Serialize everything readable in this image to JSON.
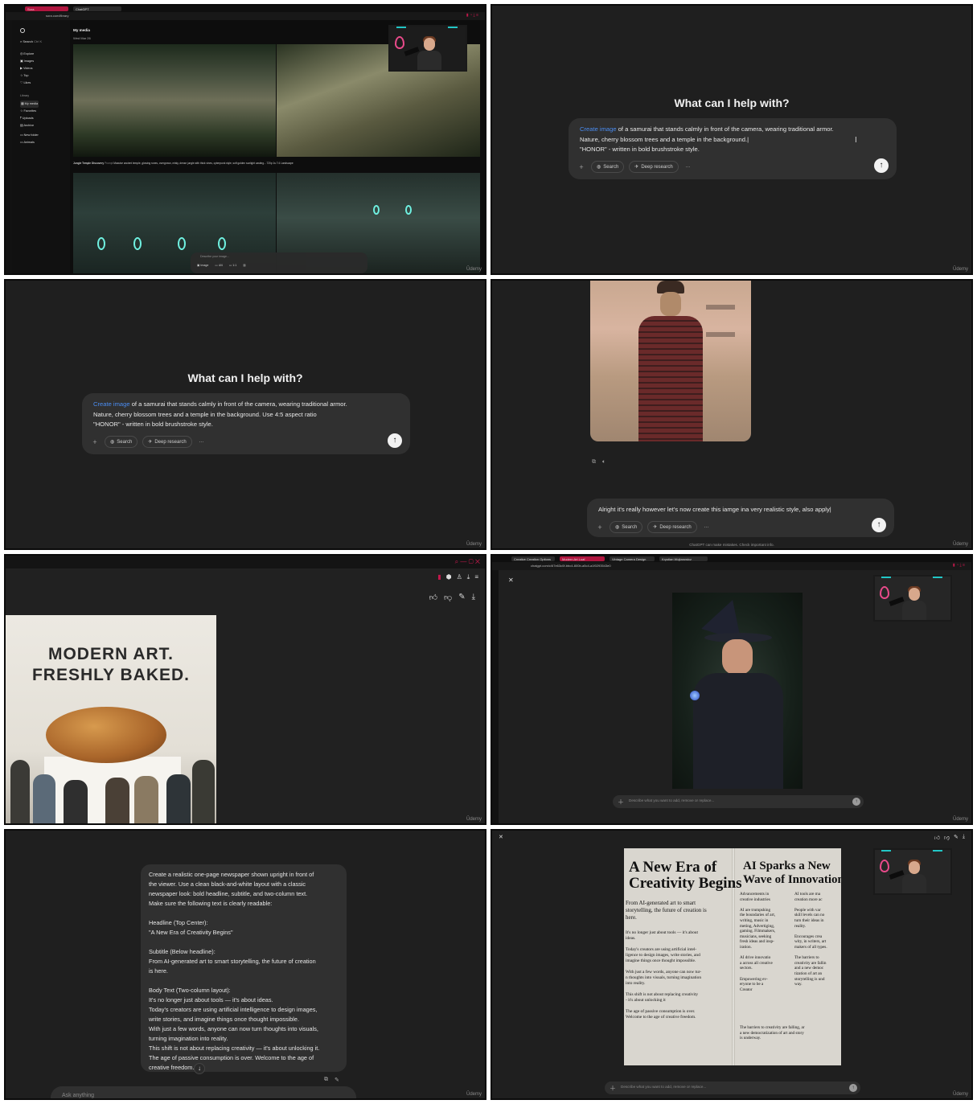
{
  "cell1": {
    "tabs": [
      "Sora",
      "ChatGPT"
    ],
    "url": "sora.com/library",
    "sidebar_search": "Search",
    "sidebar_search_shortcut": "Ctrl K",
    "nav": [
      "Explore",
      "Images",
      "Videos",
      "Top",
      "Likes"
    ],
    "library_label": "Library",
    "library": [
      "My media",
      "Favorites",
      "Uploads",
      "Archive"
    ],
    "folders": [
      "New folder",
      "Animals"
    ],
    "page_title": "My media",
    "date": "Wed Mar 26",
    "caption_title": "Jungle Temple Discovery",
    "caption_prompt_label": "Prompt",
    "caption_text": "Massive ancient temple, glowing runes, overgrown, misty, dense jungle with thick vines, cyberpunk style, soft golden sunlight casting...",
    "caption_res": "720p",
    "caption_dur": "1s",
    "caption_ratio": "7:4 Landscape",
    "composer_placeholder": "Describe your image...",
    "composer_type": "Image",
    "composer_count": "4/4",
    "composer_ratio": "1:1"
  },
  "cell2": {
    "heading": "What can I help with?",
    "link": "Create image",
    "line1": " of a samurai that stands calmly in front of the camera, wearing traditional armor.",
    "line2": "Nature, cherry blossom trees and a temple in the background.",
    "line3": "\"HONOR\" - written in bold brushstroke style.",
    "search": "Search",
    "deep": "Deep research",
    "more": "···",
    "watermark": "Ūdemy"
  },
  "cell3": {
    "heading": "What can I help with?",
    "link": "Create image",
    "line1": " of a samurai that stands calmly in front of the camera, wearing traditional armor.",
    "line2": "Nature, cherry blossom trees and a temple in the background. Use 4:5 aspect ratio",
    "line3": "\"HONOR\" - written in bold brushstroke style.",
    "search": "Search",
    "deep": "Deep research",
    "more": "···",
    "watermark": "Ūdemy"
  },
  "cell4": {
    "prompt": "Alright it's really however let's now create this iamge ina very realistic style, also apply",
    "search": "Search",
    "deep": "Deep research",
    "more": "···",
    "disclaimer": "ChatGPT can make mistakes. Check important info.",
    "watermark": "Ūdemy"
  },
  "cell5": {
    "poster_line1": "MODERN ART.",
    "poster_line2": "FRESHLY BAKED.",
    "watermark": "Ūdemy"
  },
  "cell6": {
    "tabs": [
      "Creative Creation Options",
      "Modern Art Loaf",
      "Vintage Camera Design",
      "Krystian Wojtarowicz"
    ],
    "url": "chatgpt.com/c/67e63c0f-bbc4-800b-a5c4-a1f0293543e0",
    "composer_placeholder": "Describe what you want to add, remove or replace...",
    "watermark": "Ūdemy"
  },
  "cell7": {
    "message_lines": [
      "Create a realistic one-page newspaper shown upright in front of",
      "the viewer. Use a clean black-and-white layout with a classic",
      "newspaper look: bold headline, subtitle, and two-column text.",
      "Make sure the following text is clearly readable:",
      "",
      "Headline (Top Center):",
      "\"A New Era of Creativity Begins\"",
      "",
      "Subtitle (Below headline):",
      "From AI-generated art to smart storytelling, the future of creation",
      "is here.",
      "",
      "Body Text (Two-column layout):",
      "It's no longer just about tools — it's about ideas.",
      "Today's creators are using artificial intelligence to design images,",
      "write stories, and imagine things once thought impossible.",
      "With just a few words, anyone can now turn thoughts into visuals,",
      "turning imagination into reality.",
      "This shift is not about replacing creativity — it's about unlocking it.",
      "The age of passive consumption is over. Welcome to the age of",
      "creative freedom."
    ],
    "composer_placeholder": "Ask anything",
    "watermark": "Ūdemy"
  },
  "cell8": {
    "left_headline_1": "A New Era of",
    "left_headline_2": "Creativity Begins",
    "left_subtitle": "From AI-generated art to smart\nstorytelling, the future of creation is\nhere.",
    "left_col": "It's no longer just about tools — it's about\nideas.\n\nToday's creators are using artificial intel-\nligence to design images, write stories, and\nimagine things once thought impossible.\n\nWith just a few words, anyone can now tur-\nn thoughts into visuals, turning imagination\ninto reality.\n\nThis shift is not about replacing creativity\n- it's about unlocking it\n\nThe age of passive consumption is over.\nWelcome to the age of creative freedom.",
    "right_headline_1": "AI Sparks a New",
    "right_headline_2": "Wave of Innovation",
    "right_col_a": "Advancements in\ncreative industries\n\nAI are trumpshing\nthe boundaries of art,\nwriting, music in\nmeting, Advertiging,\ngaming. Filmmakers,\nmusicians, seeking\nfresh ideas and insp-\niration.\n\nAI drive innovatio\na across all creative\nsectors.\n\nEmpowering ev-\neryone to be a\nCreator",
    "right_col_b": "AI tools are ma\ncreation more ac\n\nPeople with var\nskill levels can no\nturn their ideas in\nreality.\n\nEncourages crea\nwity, in writers, art\nmakers of all types.\n\nThe barriers to\ncreativity are fallin\nand a new democ\ntization of art an\nstorytelling is und\nway.",
    "right_footer": "The barriers to creativity are falling, ar\na new democratization of art and story\nis underway.",
    "composer_placeholder": "Describe what you want to add, remove or replace...",
    "watermark": "Ūdemy"
  }
}
